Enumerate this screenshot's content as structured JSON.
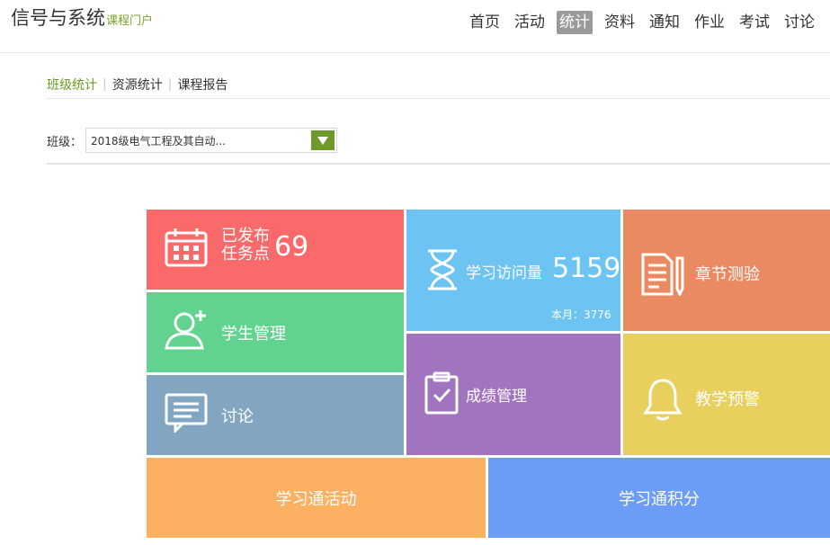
{
  "header": {
    "title": "信号与系统",
    "subtitle": "课程门户",
    "nav": [
      "首页",
      "活动",
      "统计",
      "资料",
      "通知",
      "作业",
      "考试",
      "讨论"
    ],
    "active_nav": "统计"
  },
  "subtabs": {
    "items": [
      "班级统计",
      "资源统计",
      "课程报告"
    ],
    "active": "班级统计"
  },
  "class_filter": {
    "label": "班级：",
    "selected": "2018级电气工程及其自动..."
  },
  "tiles": {
    "tasks": {
      "label_line1": "已发布",
      "label_line2": "任务点",
      "value": "69",
      "icon": "calendar-icon"
    },
    "students": {
      "label": "学生管理",
      "icon": "add-user-icon"
    },
    "discussion": {
      "label": "讨论",
      "icon": "chat-icon"
    },
    "visits": {
      "label": "学习访问量",
      "value": "5159",
      "month_label": "本月：3776",
      "icon": "hourglass-icon"
    },
    "grades": {
      "label": "成绩管理",
      "icon": "clipboard-check-icon"
    },
    "chapter_quiz": {
      "label": "章节测验",
      "icon": "document-pencil-icon"
    },
    "warning": {
      "label": "教学预警",
      "icon": "bell-icon"
    },
    "activities": {
      "label": "学习通活动"
    },
    "points": {
      "label": "学习通积分"
    }
  },
  "colors": {
    "accent": "#6a9a1f",
    "tile_tasks": "#fb6a6b",
    "tile_students": "#62d28f",
    "tile_discussion": "#82a6c2",
    "tile_visits": "#6dc4f3",
    "tile_grades": "#a274bf",
    "tile_quiz": "#ea8a62",
    "tile_warning": "#e9cf5e",
    "tile_activities": "#fcb062",
    "tile_points": "#6b9cf6"
  }
}
